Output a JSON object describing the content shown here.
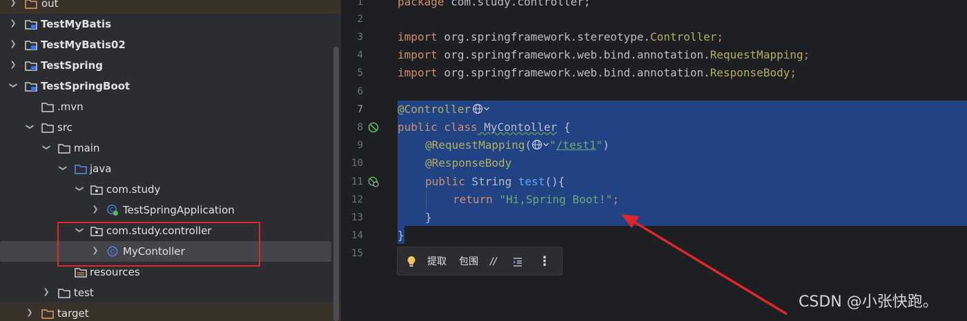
{
  "tree": {
    "items": [
      {
        "label": "out"
      },
      {
        "label": "TestMyBatis"
      },
      {
        "label": "TestMyBatis02"
      },
      {
        "label": "TestSpring"
      },
      {
        "label": "TestSpringBoot"
      },
      {
        "label": ".mvn"
      },
      {
        "label": "src"
      },
      {
        "label": "main"
      },
      {
        "label": "java"
      },
      {
        "label": "com.study"
      },
      {
        "label": "TestSpringApplication"
      },
      {
        "label": "com.study.controller"
      },
      {
        "label": "MyContoller"
      },
      {
        "label": "resources"
      },
      {
        "label": "test"
      },
      {
        "label": "target"
      }
    ]
  },
  "editor": {
    "line_numbers": [
      "1",
      "2",
      "3",
      "4",
      "5",
      "6",
      "7",
      "8",
      "9",
      "10",
      "11",
      "12",
      "13",
      "14",
      "15"
    ],
    "code": {
      "l1_kw": "package",
      "l1_rest": " com.study.controller;",
      "l3_kw": "import",
      "l3_pkg": " org.springframework.stereotype.",
      "l3_cls": "Controller",
      "l3_end": ";",
      "l4_kw": "import",
      "l4_pkg": " org.springframework.web.bind.annotation.",
      "l4_cls": "RequestMapping",
      "l4_end": ";",
      "l5_kw": "import",
      "l5_pkg": " org.springframework.web.bind.annotation.",
      "l5_cls": "ResponseBody",
      "l5_end": ";",
      "l7_ann": "@Controller",
      "l8_kw": "public class",
      "l8_name": " MyContoller",
      "l8_end": " {",
      "l9_ann": "@RequestMapping",
      "l9_open": "(",
      "l9_str_q1": "\"",
      "l9_str": "/test1",
      "l9_str_q2": "\"",
      "l9_close": ")",
      "l10_ann": "@ResponseBody",
      "l11_kw": "public",
      "l11_type": " String ",
      "l11_fn": "test",
      "l11_end": "(){",
      "l12_kw": "return",
      "l12_str": " \"Hi,Spring Boot!\"",
      "l12_end": ";",
      "l13": "}",
      "l14": "}"
    }
  },
  "popup": {
    "extract_label": "提取",
    "surround_label": "包围",
    "comment_label": "//"
  },
  "watermark": "CSDN @小张快跑。",
  "colors": {
    "selection": "#214283",
    "highlight_box": "#e0262b",
    "arrow": "#e0262b"
  }
}
